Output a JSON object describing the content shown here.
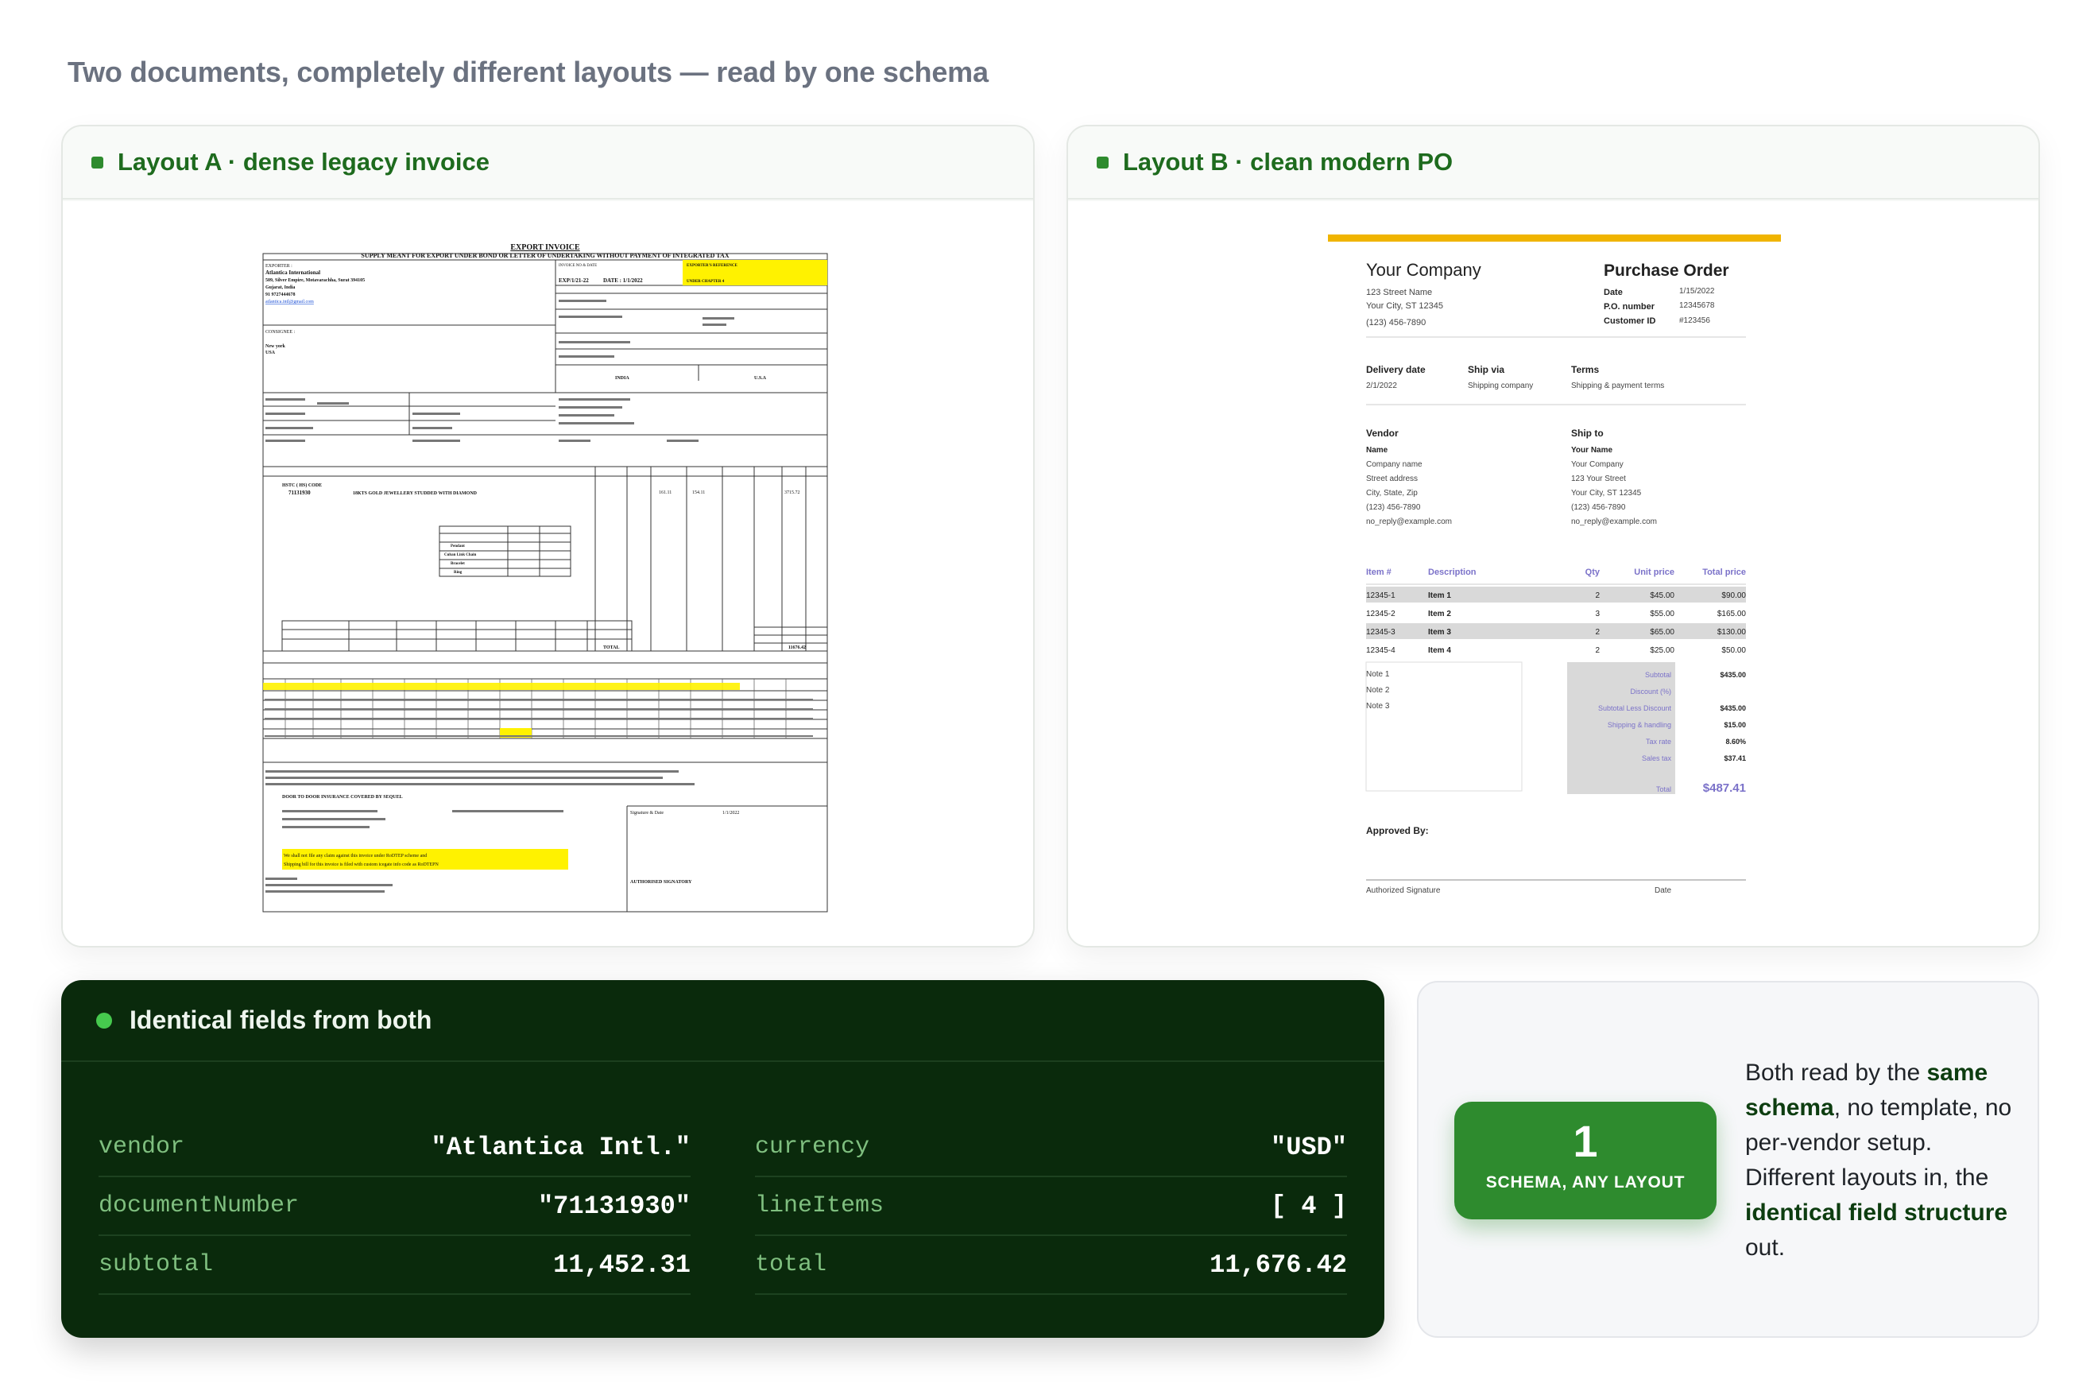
{
  "heading": "Two documents, completely different layouts — read by one schema",
  "layout_a": {
    "title": "Layout A · dense legacy invoice",
    "invoice": {
      "title": "EXPORT INVOICE",
      "subtitle": "SUPPLY MEANT FOR EXPORT UNDER BOND OR LETTER OF UNDERTAKING WITHOUT PAYMENT OF INTEGRATED TAX",
      "exporter_label": "EXPORTER :",
      "exporter_name": "Atlantica International",
      "exporter_addr1": "509, Silver Empire, Motavarachha, Surat 394105",
      "exporter_addr2": "Gujarat, India",
      "exporter_phone": "91 9727444678",
      "exporter_email": "atlantica.intl@gmail.com",
      "invoice_no_label": "INVOICE NO & DATE",
      "exporter_ref_label": "EXPORTER'S REFERENCE",
      "invoice_no": "EXP/1/21-22",
      "invoice_date": "DATE : 1/1/2022",
      "chapter": "UNDER CHAPTER 4",
      "consignee_label": "CONSIGNEE :",
      "consignee_city": "New york",
      "consignee_country": "USA",
      "origin_country": "INDIA",
      "destination_country": "U.S.A",
      "hs_code": "HSTC ( HS) CODE",
      "hs_number": "71131930",
      "description": "18KTS GOLD JEWELLERY STUDDED WITH DIAMOND",
      "items": [
        "Pendant",
        "Cuban Link Chain",
        "Bracelet",
        "Ring"
      ],
      "net_wt": "154.11",
      "gross_wt": "161.11",
      "value": "3715.72",
      "total_label": "TOTAL",
      "total_usd": "11676.42",
      "insurance": "DOOR TO DOOR INSURANCE COVERED BY SEQUEL",
      "note_yellow_1": "We shall not file any claim against this invoice under RoDTEP scheme and",
      "note_yellow_2": "Shipping bill for this invoice is filed with custom icegate info code as RoDTEPN",
      "signature_label": "Signature & Date",
      "signature_date": "1/1/2022",
      "signatory": "AUTHORISED SIGNATORY"
    }
  },
  "layout_b": {
    "title": "Layout B · clean modern PO",
    "po": {
      "company": "Your Company",
      "street": "123 Street Name",
      "city": "Your City, ST 12345",
      "phone": "(123) 456-7890",
      "doc_title": "Purchase Order",
      "date_label": "Date",
      "date_value": "1/15/2022",
      "po_label": "P.O. number",
      "po_value": "12345678",
      "customer_label": "Customer ID",
      "customer_value": "#123456",
      "delivery_label": "Delivery date",
      "delivery_value": "2/1/2022",
      "shipvia_label": "Ship via",
      "shipvia_value": "Shipping company",
      "terms_label": "Terms",
      "terms_value": "Shipping & payment terms",
      "vendor_label": "Vendor",
      "vendor_lines": [
        "Name",
        "Company name",
        "Street address",
        "City, State, Zip",
        "(123) 456-7890",
        "no_reply@example.com"
      ],
      "shipto_label": "Ship to",
      "shipto_lines": [
        "Your Name",
        "Your Company",
        "123 Your Street",
        "Your City, ST 12345",
        "(123) 456-7890",
        "no_reply@example.com"
      ],
      "col_item": "Item #",
      "col_desc": "Description",
      "col_qty": "Qty",
      "col_unit": "Unit price",
      "col_total": "Total price",
      "rows": [
        {
          "item": "12345-1",
          "desc": "Item 1",
          "qty": "2",
          "unit": "$45.00",
          "total": "$90.00"
        },
        {
          "item": "12345-2",
          "desc": "Item 2",
          "qty": "3",
          "unit": "$55.00",
          "total": "$165.00"
        },
        {
          "item": "12345-3",
          "desc": "Item 3",
          "qty": "2",
          "unit": "$65.00",
          "total": "$130.00"
        },
        {
          "item": "12345-4",
          "desc": "Item 4",
          "qty": "2",
          "unit": "$25.00",
          "total": "$50.00"
        }
      ],
      "notes": [
        "Note 1",
        "Note 2",
        "Note 3"
      ],
      "summary_labels": [
        "Subtotal",
        "Discount (%)",
        "Subtotal Less Discount",
        "Shipping & handling",
        "Tax rate",
        "Sales tax"
      ],
      "summary_values": [
        "$435.00",
        "",
        "$435.00",
        "$15.00",
        "8.60%",
        "$37.41"
      ],
      "total_label": "Total",
      "total_value": "$487.41",
      "approved_label": "Approved By:",
      "signature_label": "Authorized Signature",
      "date_footer": "Date"
    }
  },
  "fields_panel": {
    "title": "Identical fields from both",
    "left": [
      {
        "key": "vendor",
        "value": "\"Atlantica Intl.\""
      },
      {
        "key": "documentNumber",
        "value": "\"71131930\""
      },
      {
        "key": "subtotal",
        "value": "11,452.31"
      }
    ],
    "right": [
      {
        "key": "currency",
        "value": "\"USD\""
      },
      {
        "key": "lineItems",
        "value": "[ 4 ]"
      },
      {
        "key": "total",
        "value": "11,676.42"
      }
    ]
  },
  "aside": {
    "number": "1",
    "label": "SCHEMA, ANY LAYOUT",
    "t1": "Both read by the ",
    "b1": "same schema",
    "t2": ", no template, no per-vendor setup. Different layouts in, the ",
    "b2": "identical field structure",
    "t3": " out."
  },
  "colors": {
    "accent_green": "#2e8b2e",
    "dark_panel": "#0a2a0c",
    "po_gold": "#f0b400",
    "invoice_highlight": "#fff200"
  }
}
